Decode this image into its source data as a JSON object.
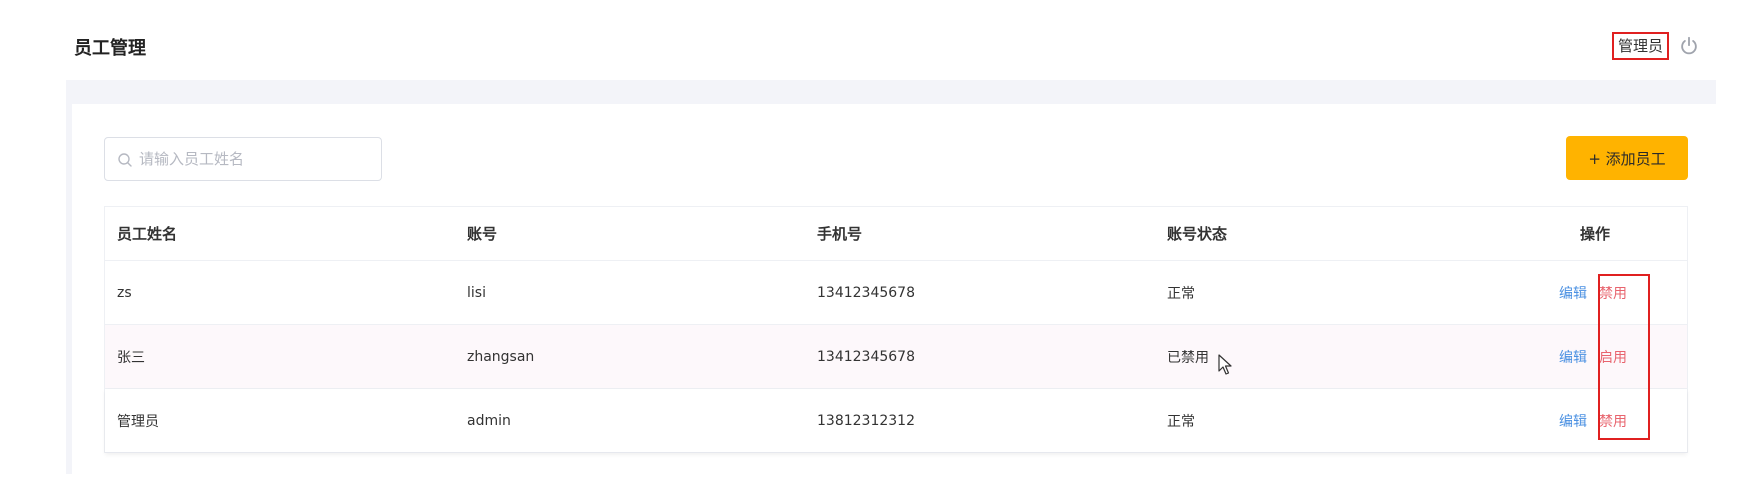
{
  "header": {
    "title": "员工管理",
    "user_label": "管理员",
    "logout_icon": "power-icon"
  },
  "search": {
    "placeholder": "请输入员工姓名",
    "value": "",
    "icon": "search-icon"
  },
  "toolbar": {
    "add_label": "+ 添加员工"
  },
  "table": {
    "columns": [
      "员工姓名",
      "账号",
      "手机号",
      "账号状态",
      "操作"
    ],
    "rows": [
      {
        "name": "zs",
        "account": "lisi",
        "phone": "13412345678",
        "status": "正常",
        "edit": "编辑",
        "toggle": "禁用"
      },
      {
        "name": "张三",
        "account": "zhangsan",
        "phone": "13412345678",
        "status": "已禁用",
        "edit": "编辑",
        "toggle": "启用"
      },
      {
        "name": "管理员",
        "account": "admin",
        "phone": "13812312312",
        "status": "正常",
        "edit": "编辑",
        "toggle": "禁用"
      }
    ]
  },
  "colors": {
    "accent": "#ffb300",
    "link": "#4a90e2",
    "danger": "#e8646e",
    "highlight_box": "#e02020"
  }
}
